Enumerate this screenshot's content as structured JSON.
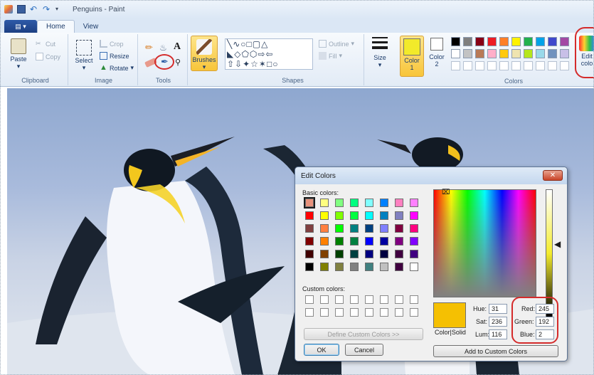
{
  "window": {
    "title": "Penguins - Paint"
  },
  "tabs": {
    "home": "Home",
    "view": "View"
  },
  "clipboard": {
    "paste": "Paste",
    "cut": "Cut",
    "copy": "Copy",
    "label": "Clipboard"
  },
  "image": {
    "select": "Select",
    "crop": "Crop",
    "resize": "Resize",
    "rotate": "Rotate",
    "label": "Image"
  },
  "tools": {
    "text_tool": "A",
    "label": "Tools"
  },
  "brushes": {
    "label": "Brushes"
  },
  "shapes": {
    "outline": "Outline",
    "fill": "Fill",
    "label": "Shapes"
  },
  "size": {
    "label": "Size"
  },
  "colors_group": {
    "color1": "Color",
    "color1_num": "1",
    "color2": "Color",
    "color2_num": "2",
    "label": "Colors",
    "edit_colors": "Edit",
    "edit_colors_2": "colo",
    "palette_row1": [
      "#000000",
      "#7f7f7f",
      "#880015",
      "#ed1c24",
      "#ff7f27",
      "#fff200",
      "#22b14c",
      "#00a2e8",
      "#3f48cc",
      "#a349a4"
    ],
    "palette_row2": [
      "#ffffff",
      "#c3c3c3",
      "#b97a57",
      "#ffaec9",
      "#ffc90e",
      "#efe4b0",
      "#b5e61d",
      "#99d9ea",
      "#7092be",
      "#c8bfe7"
    ],
    "color1_value": "#f2ea2a"
  },
  "dialog": {
    "title": "Edit Colors",
    "basic_colors_label": "Basic colors:",
    "custom_colors_label": "Custom colors:",
    "define_custom_button": "Define Custom Colors >>",
    "ok_button": "OK",
    "cancel_button": "Cancel",
    "color_solid_label": "Color|Solid",
    "hue_label": "Hue:",
    "hue_value": "31",
    "sat_label": "Sat:",
    "sat_value": "236",
    "lum_label": "Lum:",
    "lum_value": "116",
    "red_label": "Red:",
    "red_value": "245",
    "green_label": "Green:",
    "green_value": "192",
    "blue_label": "Blue:",
    "blue_value": "2",
    "add_custom_button": "Add to Custom Colors",
    "preview_color": "#f5c002",
    "basic_colors": [
      "#e8927c",
      "#ffff80",
      "#80ff80",
      "#00ff80",
      "#80ffff",
      "#0080ff",
      "#ff80c0",
      "#ff80ff",
      "#ff0000",
      "#ffff00",
      "#80ff00",
      "#00ff40",
      "#00ffff",
      "#0080c0",
      "#8080c0",
      "#ff00ff",
      "#804040",
      "#ff8040",
      "#00ff00",
      "#008080",
      "#004080",
      "#8080ff",
      "#800040",
      "#ff0080",
      "#800000",
      "#ff8000",
      "#008000",
      "#008040",
      "#0000ff",
      "#0000a0",
      "#800080",
      "#8000ff",
      "#400000",
      "#804000",
      "#004000",
      "#004040",
      "#000080",
      "#000040",
      "#400040",
      "#400080",
      "#000000",
      "#808000",
      "#808040",
      "#808080",
      "#408080",
      "#c0c0c0",
      "#400040",
      "#ffffff"
    ]
  }
}
